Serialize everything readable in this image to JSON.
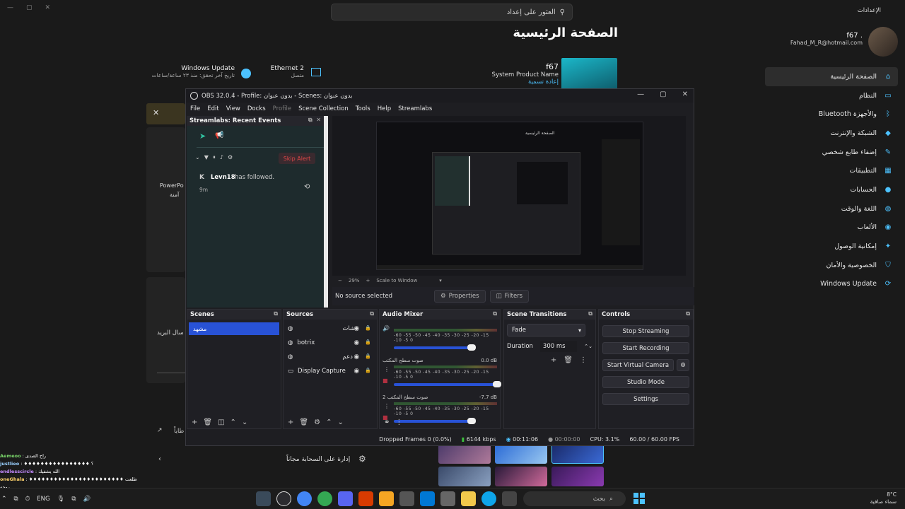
{
  "settings": {
    "window_title": "الإعدادات",
    "search_placeholder": "العثور على إعداد",
    "page_heading": "الصفحة الرئيسية",
    "account": {
      "name": "f67 .",
      "email": "Fahad_M_R@hotmail.com"
    },
    "device": {
      "name": "f67",
      "model": "System Product Name",
      "rename": "إعادة تسمية"
    },
    "status": [
      {
        "title": "Windows Update",
        "sub": "تاريخ آخر تحقق: منذ ٢٣ ساعة/ساعات"
      },
      {
        "title": "Ethernet 2",
        "sub": "متصل"
      }
    ],
    "nav": [
      {
        "label": "الصفحة الرئيسية",
        "icon": "home-icon",
        "active": true
      },
      {
        "label": "النظام",
        "icon": "system-icon"
      },
      {
        "label": "Bluetooth والأجهزة",
        "icon": "bluetooth-icon"
      },
      {
        "label": "الشبكة والإنترنت",
        "icon": "network-icon"
      },
      {
        "label": "إضفاء طابع شخصي",
        "icon": "brush-icon"
      },
      {
        "label": "التطبيقات",
        "icon": "apps-icon"
      },
      {
        "label": "الحسابات",
        "icon": "accounts-icon"
      },
      {
        "label": "اللغة والوقت",
        "icon": "globe-icon"
      },
      {
        "label": "الألعاب",
        "icon": "gamepad-icon"
      },
      {
        "label": "إمكانية الوصول",
        "icon": "accessibility-icon"
      },
      {
        "label": "الخصوصية والأمان",
        "icon": "shield-icon"
      },
      {
        "label": "Windows Update",
        "icon": "update-icon"
      }
    ],
    "left_text_1": "PowerPo",
    "left_text_2": "آمنة",
    "left_text_3": "سال البريد",
    "left_text_4": "طاياً",
    "cloud_manage": "إدارة على السحابة مجاناً"
  },
  "obs": {
    "title": "OBS 32.0.4 - Profile: بدون عنوان - Scenes: بدون عنوان",
    "menu": [
      "File",
      "Edit",
      "View",
      "Docks",
      "Profile",
      "Scene Collection",
      "Tools",
      "Help",
      "Streamlabs"
    ],
    "streamlabs": {
      "title": "Streamlabs: Recent Events",
      "skip_alert": "Skip Alert",
      "event_user": "Levn18",
      "event_text": "has followed.",
      "event_time": "9m"
    },
    "zoom": {
      "percent": "29%",
      "mode": "Scale to Window"
    },
    "source_bar": {
      "status": "No source selected",
      "properties": "Properties",
      "filters": "Filters"
    },
    "scenes": {
      "title": "Scenes",
      "items": [
        "مشهد"
      ]
    },
    "sources": {
      "title": "Sources",
      "items": [
        {
          "name": "شات",
          "icon": "browser-icon"
        },
        {
          "name": "botrix",
          "icon": "browser-icon"
        },
        {
          "name": "دعم",
          "icon": "browser-icon"
        },
        {
          "name": "Display Capture",
          "icon": "monitor-icon"
        }
      ]
    },
    "mixer": {
      "title": "Audio Mixer",
      "scale": "-60 -55 -50 -45 -40 -35 -30 -25 -20 -15 -10 -5 0",
      "channels": [
        {
          "name": "",
          "db": "",
          "level": 0.78
        },
        {
          "name": "صوت سطح المكتب",
          "db": "0.0 dB",
          "level": 1.0
        },
        {
          "name": "صوت سطح المكتب 2",
          "db": "-7.7 dB",
          "level": 0.78
        }
      ]
    },
    "transitions": {
      "title": "Scene Transitions",
      "type": "Fade",
      "duration_label": "Duration",
      "duration": "300 ms"
    },
    "controls": {
      "title": "Controls",
      "buttons": [
        "Stop Streaming",
        "Start Recording",
        "Start Virtual Camera",
        "Studio Mode",
        "Settings"
      ]
    },
    "status": {
      "dropped": "Dropped Frames 0 (0.0%)",
      "kbps": "6144 kbps",
      "stream_time": "00:11:06",
      "rec_time": "00:00:00",
      "cpu": "CPU: 3.1%",
      "fps": "60.00 / 60.00 FPS"
    }
  },
  "chat": [
    {
      "user": "Aemeoo",
      "msg": ": راح الصدى"
    },
    {
      "user": "justlieo",
      "msg": ": ♦♦♦♦♦♦♦♦♦♦♦♦♦♦♦♦ ؟"
    },
    {
      "user": "endlesscircle",
      "msg": ": الله يشفيك"
    },
    {
      "user": "oneGhala",
      "msg": ": ♦♦♦♦♦♦♦♦♦♦♦♦♦♦♦♦♦♦♦♦♦♦♦ طلعت روحه"
    },
    {
      "user": "Aemeoo",
      "msg": ": القصة تكفي"
    }
  ],
  "taskbar": {
    "lang": "ENG",
    "search": "بحث",
    "temp": "8°C",
    "weather": "سماء صافية"
  },
  "colors": {
    "accent": "#2852d6",
    "settings_accent": "#4cc2ff",
    "skip_alert": "#e04848"
  }
}
